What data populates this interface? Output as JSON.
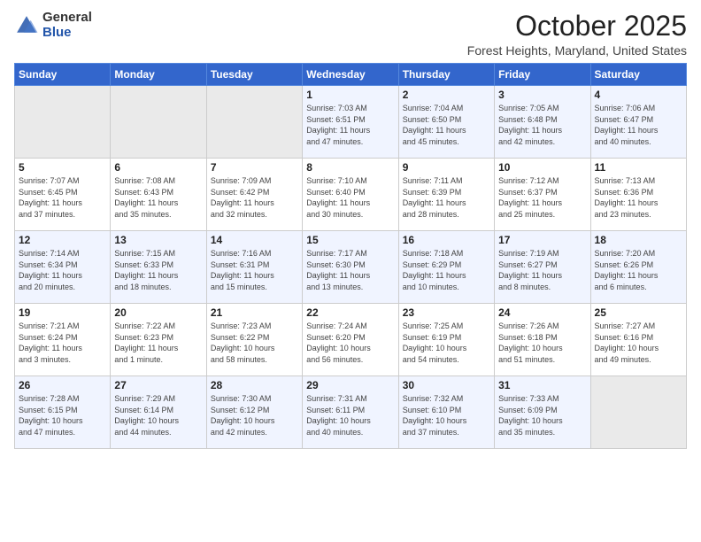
{
  "header": {
    "logo_general": "General",
    "logo_blue": "Blue",
    "title": "October 2025",
    "subtitle": "Forest Heights, Maryland, United States"
  },
  "weekdays": [
    "Sunday",
    "Monday",
    "Tuesday",
    "Wednesday",
    "Thursday",
    "Friday",
    "Saturday"
  ],
  "weeks": [
    [
      {
        "day": "",
        "info": ""
      },
      {
        "day": "",
        "info": ""
      },
      {
        "day": "",
        "info": ""
      },
      {
        "day": "1",
        "info": "Sunrise: 7:03 AM\nSunset: 6:51 PM\nDaylight: 11 hours\nand 47 minutes."
      },
      {
        "day": "2",
        "info": "Sunrise: 7:04 AM\nSunset: 6:50 PM\nDaylight: 11 hours\nand 45 minutes."
      },
      {
        "day": "3",
        "info": "Sunrise: 7:05 AM\nSunset: 6:48 PM\nDaylight: 11 hours\nand 42 minutes."
      },
      {
        "day": "4",
        "info": "Sunrise: 7:06 AM\nSunset: 6:47 PM\nDaylight: 11 hours\nand 40 minutes."
      }
    ],
    [
      {
        "day": "5",
        "info": "Sunrise: 7:07 AM\nSunset: 6:45 PM\nDaylight: 11 hours\nand 37 minutes."
      },
      {
        "day": "6",
        "info": "Sunrise: 7:08 AM\nSunset: 6:43 PM\nDaylight: 11 hours\nand 35 minutes."
      },
      {
        "day": "7",
        "info": "Sunrise: 7:09 AM\nSunset: 6:42 PM\nDaylight: 11 hours\nand 32 minutes."
      },
      {
        "day": "8",
        "info": "Sunrise: 7:10 AM\nSunset: 6:40 PM\nDaylight: 11 hours\nand 30 minutes."
      },
      {
        "day": "9",
        "info": "Sunrise: 7:11 AM\nSunset: 6:39 PM\nDaylight: 11 hours\nand 28 minutes."
      },
      {
        "day": "10",
        "info": "Sunrise: 7:12 AM\nSunset: 6:37 PM\nDaylight: 11 hours\nand 25 minutes."
      },
      {
        "day": "11",
        "info": "Sunrise: 7:13 AM\nSunset: 6:36 PM\nDaylight: 11 hours\nand 23 minutes."
      }
    ],
    [
      {
        "day": "12",
        "info": "Sunrise: 7:14 AM\nSunset: 6:34 PM\nDaylight: 11 hours\nand 20 minutes."
      },
      {
        "day": "13",
        "info": "Sunrise: 7:15 AM\nSunset: 6:33 PM\nDaylight: 11 hours\nand 18 minutes."
      },
      {
        "day": "14",
        "info": "Sunrise: 7:16 AM\nSunset: 6:31 PM\nDaylight: 11 hours\nand 15 minutes."
      },
      {
        "day": "15",
        "info": "Sunrise: 7:17 AM\nSunset: 6:30 PM\nDaylight: 11 hours\nand 13 minutes."
      },
      {
        "day": "16",
        "info": "Sunrise: 7:18 AM\nSunset: 6:29 PM\nDaylight: 11 hours\nand 10 minutes."
      },
      {
        "day": "17",
        "info": "Sunrise: 7:19 AM\nSunset: 6:27 PM\nDaylight: 11 hours\nand 8 minutes."
      },
      {
        "day": "18",
        "info": "Sunrise: 7:20 AM\nSunset: 6:26 PM\nDaylight: 11 hours\nand 6 minutes."
      }
    ],
    [
      {
        "day": "19",
        "info": "Sunrise: 7:21 AM\nSunset: 6:24 PM\nDaylight: 11 hours\nand 3 minutes."
      },
      {
        "day": "20",
        "info": "Sunrise: 7:22 AM\nSunset: 6:23 PM\nDaylight: 11 hours\nand 1 minute."
      },
      {
        "day": "21",
        "info": "Sunrise: 7:23 AM\nSunset: 6:22 PM\nDaylight: 10 hours\nand 58 minutes."
      },
      {
        "day": "22",
        "info": "Sunrise: 7:24 AM\nSunset: 6:20 PM\nDaylight: 10 hours\nand 56 minutes."
      },
      {
        "day": "23",
        "info": "Sunrise: 7:25 AM\nSunset: 6:19 PM\nDaylight: 10 hours\nand 54 minutes."
      },
      {
        "day": "24",
        "info": "Sunrise: 7:26 AM\nSunset: 6:18 PM\nDaylight: 10 hours\nand 51 minutes."
      },
      {
        "day": "25",
        "info": "Sunrise: 7:27 AM\nSunset: 6:16 PM\nDaylight: 10 hours\nand 49 minutes."
      }
    ],
    [
      {
        "day": "26",
        "info": "Sunrise: 7:28 AM\nSunset: 6:15 PM\nDaylight: 10 hours\nand 47 minutes."
      },
      {
        "day": "27",
        "info": "Sunrise: 7:29 AM\nSunset: 6:14 PM\nDaylight: 10 hours\nand 44 minutes."
      },
      {
        "day": "28",
        "info": "Sunrise: 7:30 AM\nSunset: 6:12 PM\nDaylight: 10 hours\nand 42 minutes."
      },
      {
        "day": "29",
        "info": "Sunrise: 7:31 AM\nSunset: 6:11 PM\nDaylight: 10 hours\nand 40 minutes."
      },
      {
        "day": "30",
        "info": "Sunrise: 7:32 AM\nSunset: 6:10 PM\nDaylight: 10 hours\nand 37 minutes."
      },
      {
        "day": "31",
        "info": "Sunrise: 7:33 AM\nSunset: 6:09 PM\nDaylight: 10 hours\nand 35 minutes."
      },
      {
        "day": "",
        "info": ""
      }
    ]
  ]
}
